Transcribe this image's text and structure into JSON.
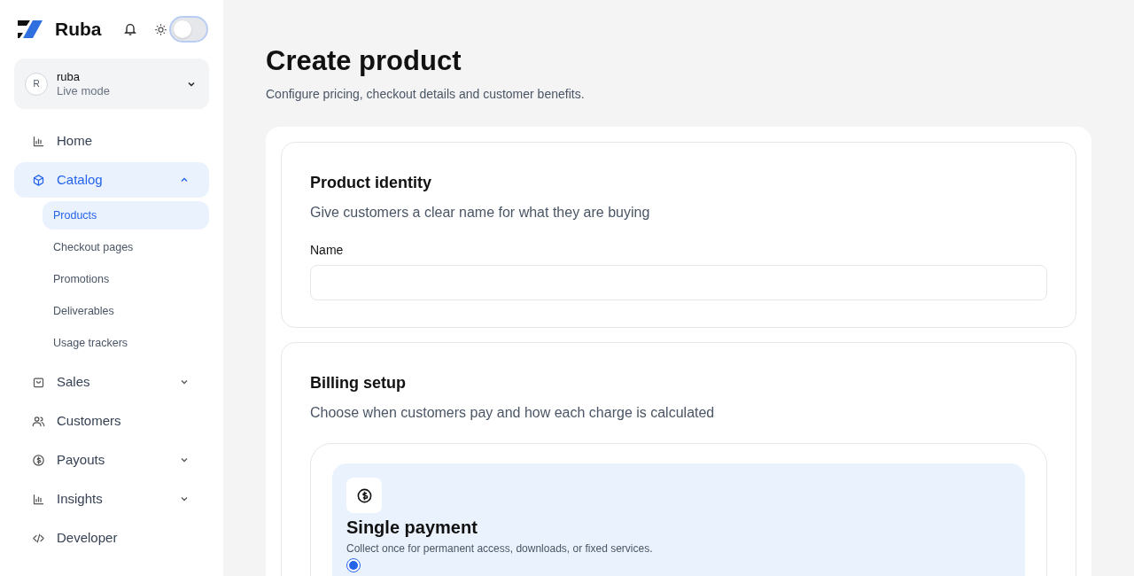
{
  "brand": {
    "name": "Ruba"
  },
  "theme_toggle": {
    "on": false
  },
  "account": {
    "avatar": "R",
    "name": "ruba",
    "mode": "Live mode"
  },
  "sidebar": {
    "items": [
      {
        "label": "Home",
        "selected": false
      },
      {
        "label": "Catalog",
        "selected": true,
        "expanded": true,
        "children": [
          {
            "label": "Products",
            "selected": true
          },
          {
            "label": "Checkout pages",
            "selected": false
          },
          {
            "label": "Promotions",
            "selected": false
          },
          {
            "label": "Deliverables",
            "selected": false
          },
          {
            "label": "Usage trackers",
            "selected": false
          }
        ]
      },
      {
        "label": "Sales",
        "selected": false,
        "expanded": false
      },
      {
        "label": "Customers",
        "selected": false
      },
      {
        "label": "Payouts",
        "selected": false,
        "expanded": false
      },
      {
        "label": "Insights",
        "selected": false,
        "expanded": false
      },
      {
        "label": "Developer",
        "selected": false
      }
    ]
  },
  "page": {
    "title": "Create product",
    "subtitle": "Configure pricing, checkout details and customer benefits."
  },
  "identity": {
    "title": "Product identity",
    "subtitle": "Give customers a clear name for what they are buying",
    "name_label": "Name"
  },
  "billing": {
    "title": "Billing setup",
    "subtitle": "Choose when customers pay and how each charge is calculated",
    "options": [
      {
        "title": "Single payment",
        "description": "Collect once for permanent access, downloads, or fixed services.",
        "selected": true
      }
    ]
  }
}
